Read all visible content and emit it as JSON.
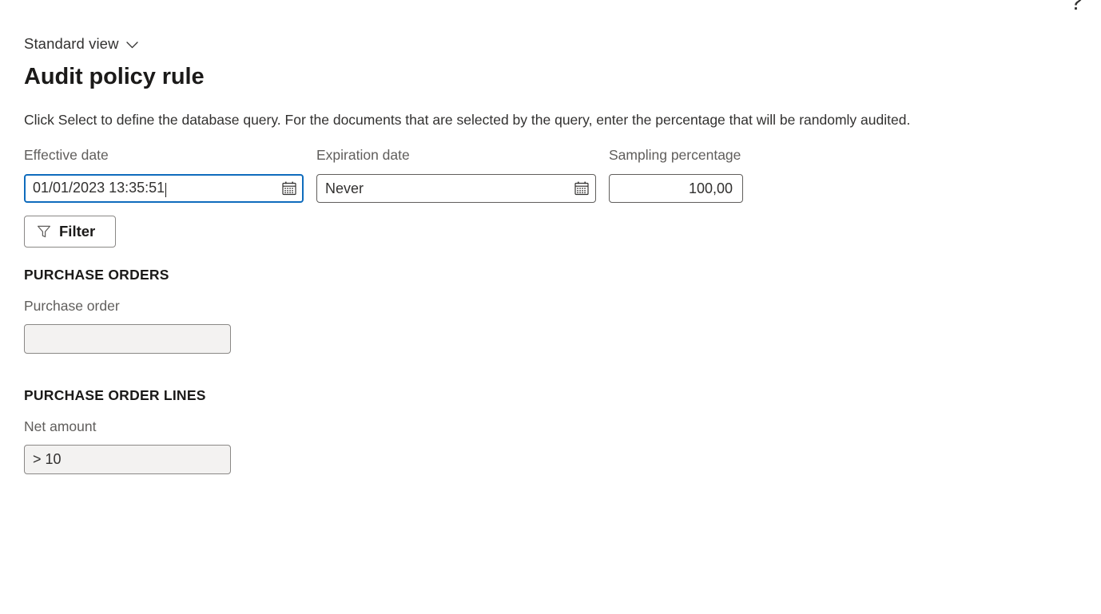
{
  "header": {
    "help_icon": "question-mark-help-icon",
    "help_glyph": "?",
    "view_selector_label": "Standard view",
    "view_selector_chevron": "chevron-down-icon",
    "page_title": "Audit policy rule"
  },
  "description": "Click Select to define the database query. For the documents that are selected by the query, enter the percentage that will be randomly audited.",
  "form": {
    "effective_date": {
      "label": "Effective date",
      "value": "01/01/2023 13:35:51",
      "placeholder": "",
      "icon": "calendar-icon",
      "focused": true
    },
    "expiration_date": {
      "label": "Expiration date",
      "value": "Never",
      "placeholder": "",
      "icon": "calendar-icon",
      "focused": false
    },
    "sampling_percentage": {
      "label": "Sampling percentage",
      "value": "100,00",
      "placeholder": "",
      "focused": false
    },
    "filter_button": {
      "label": "Filter",
      "icon": "funnel-filter-icon"
    }
  },
  "sections": [
    {
      "heading": "PURCHASE ORDERS",
      "field": {
        "label": "Purchase order",
        "value": "",
        "placeholder": ""
      }
    },
    {
      "heading": "PURCHASE ORDER LINES",
      "field": {
        "label": "Net amount",
        "value": "> 10",
        "placeholder": ""
      }
    }
  ],
  "colors": {
    "focus_blue": "#0f6cbd",
    "label_gray": "#605e5c",
    "text_dark": "#323130",
    "field_border": "#605e5c",
    "field_fill_disabled": "#f3f2f1",
    "page_background": "#ffffff"
  }
}
